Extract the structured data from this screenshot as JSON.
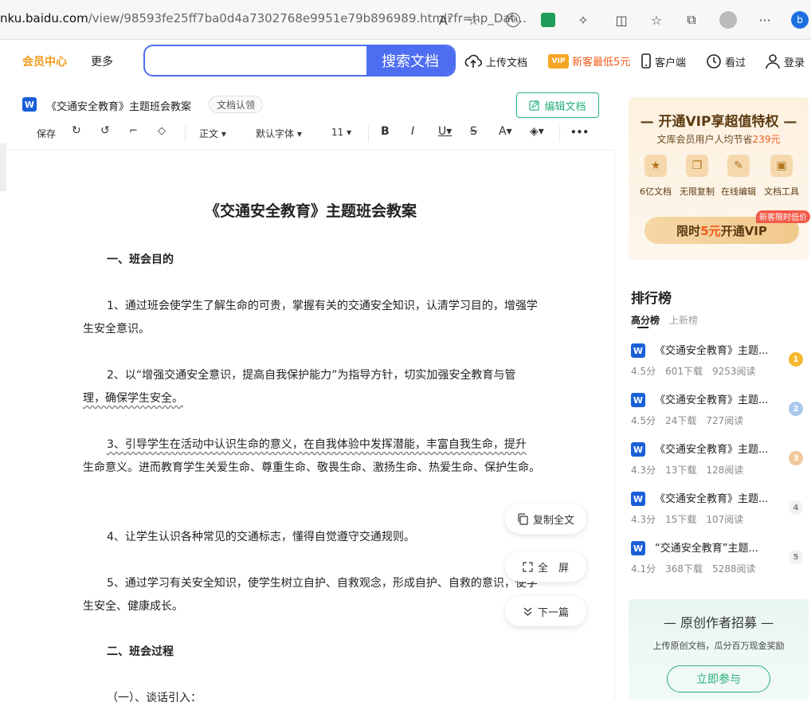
{
  "browser": {
    "url_domain": "nku.baidu.com",
    "url_rest": "/view/98593fe25ff7ba0d4a7302768e9951e79b896989.html?fr=hp_Dat..."
  },
  "topnav": {
    "vip_center": "会员中心",
    "more": "更多",
    "search_value": "",
    "search_button": "搜索文档",
    "upload": "上传文档",
    "promo": "新客最低5元",
    "client": "客户端",
    "viewed": "看过",
    "login": "登录"
  },
  "doc_header": {
    "title": "《交通安全教育》主题班会教案",
    "claim": "文档认领",
    "edit": "编辑文档",
    "doc_icon_letter": "W"
  },
  "toolbar": {
    "save": "保存",
    "style": "正文",
    "font": "默认字体",
    "size": "11",
    "more": "•••"
  },
  "document": {
    "title": "《交通安全教育》主题班会教案",
    "h1": "一、班会目的",
    "p1": "1、通过班会使学生了解生命的可贵，掌握有关的交通安全知识，认清学习目的，增强学生安全意识。",
    "p2a": "2、以“增强交通安全意识，提高自我保护能力”为指导方针，切实加强安全教育与管",
    "p2b": "理，确保学生安全。",
    "p3a": "3、引导学生在活动中认识生命的意义，在自我体验中发挥潜能，丰富自我生命，提升",
    "p3b": "生命意义。进而教育学生关爱生命、尊重生命、敬畏生命、激扬生命、热爱生命、保护生命。",
    "p4": "4、让学生认识各种常见的交通标志，懂得自觉遵守交通规则。",
    "p5": "5、通过学习有关安全知识，使学生树立自护、自救观念，形成自护、自救的意识，使学生安全、健康成长。",
    "h2": "二、班会过程",
    "p6": "（一）、谈话引入："
  },
  "float_buttons": {
    "copy": "复制全文",
    "fullscreen": "全　屏",
    "next": "下一篇"
  },
  "vip_card": {
    "title": "开通VIP享超值特权",
    "sub_prefix": "文库会员用户人均节省",
    "sub_amount": "239元",
    "perks": [
      "6亿文档",
      "无限复制",
      "在线编辑",
      "文档工具"
    ],
    "newbie_tag": "新客限时低价",
    "btn_prefix": "限时",
    "btn_amount": "5元",
    "btn_suffix": "开通VIP"
  },
  "ranking": {
    "title": "排行榜",
    "tab_active": "高分榜",
    "tab_other": "上新榜",
    "items": [
      {
        "title": "《交通安全教育》主题...",
        "score": "4.5分",
        "downloads": "601下载",
        "reads": "9253阅读",
        "rank": "1"
      },
      {
        "title": "《交通安全教育》主题...",
        "score": "4.5分",
        "downloads": "24下载",
        "reads": "727阅读",
        "rank": "2"
      },
      {
        "title": "《交通安全教育》主题...",
        "score": "4.3分",
        "downloads": "13下载",
        "reads": "128阅读",
        "rank": "3"
      },
      {
        "title": "《交通安全教育》主题...",
        "score": "4.3分",
        "downloads": "15下载",
        "reads": "107阅读",
        "rank": "4"
      },
      {
        "title": "“交通安全教育”主题...",
        "score": "4.1分",
        "downloads": "368下载",
        "reads": "5288阅读",
        "rank": "5"
      }
    ]
  },
  "recruit": {
    "title": "原创作者招募",
    "sub": "上传原创文档，瓜分百万现金奖励",
    "btn": "立即参与"
  },
  "colors": {
    "brand_blue": "#4e6ef2",
    "vip_orange": "#f39a1a",
    "green": "#28b17b"
  }
}
